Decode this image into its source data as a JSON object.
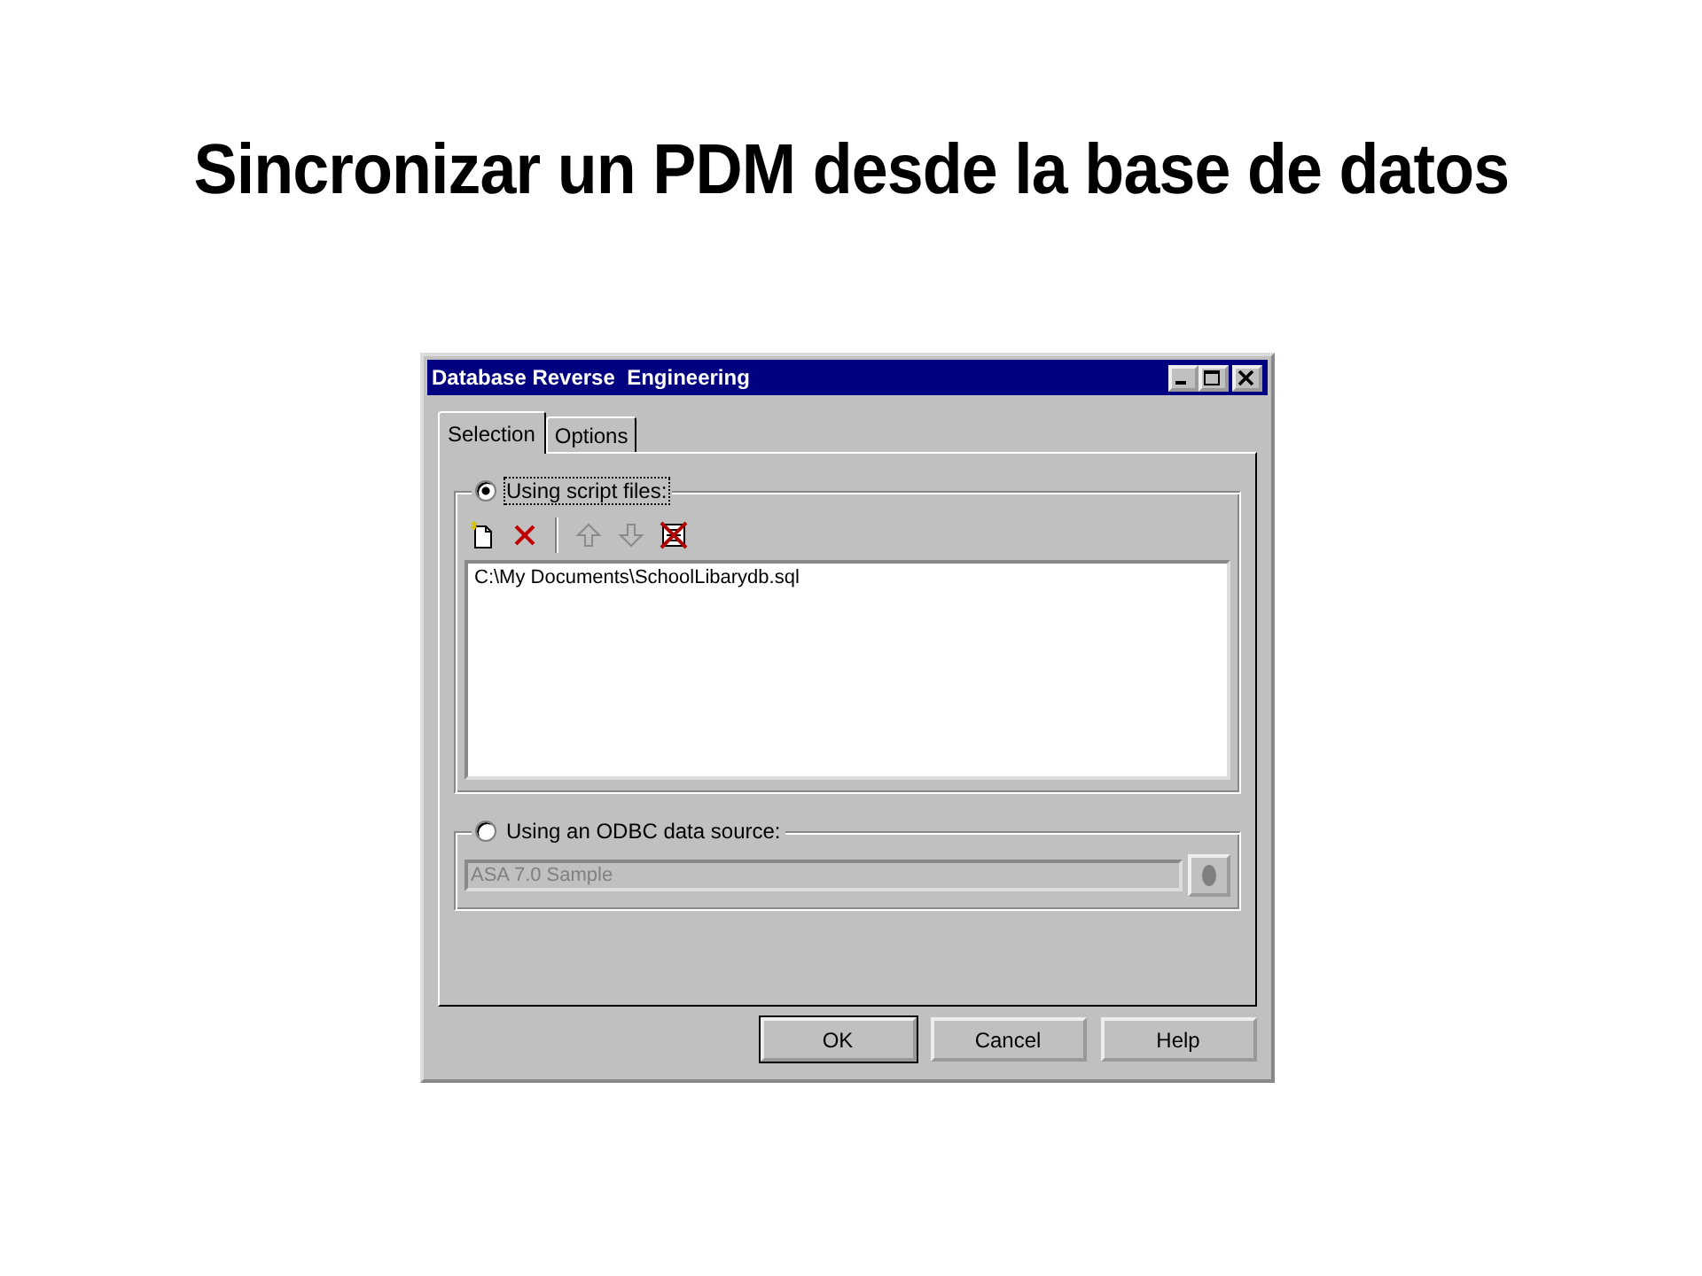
{
  "slide_title": "Sincronizar un PDM desde la base de datos",
  "window": {
    "title": "Database Reverse  Engineering"
  },
  "tabs": [
    {
      "label": "Selection",
      "selected": true
    },
    {
      "label": "Options",
      "selected": false
    }
  ],
  "sources": [
    {
      "kind": "files",
      "label": "Using script files:",
      "selected": true
    },
    {
      "kind": "odbc",
      "label": "Using an ODBC data source:",
      "selected": false
    }
  ],
  "toolbar": [
    {
      "kind": "new",
      "disabled": false
    },
    {
      "kind": "delete",
      "disabled": false
    },
    {
      "kind": "up",
      "disabled": true
    },
    {
      "kind": "down",
      "disabled": true
    },
    {
      "kind": "clear",
      "disabled": false
    }
  ],
  "files": [
    "C:\\My Documents\\SchoolLibarydb.sql"
  ],
  "odbc_field": {
    "value": "ASA 7.0 Sample",
    "disabled": true
  },
  "buttons": [
    "OK",
    "Cancel",
    "Help"
  ]
}
